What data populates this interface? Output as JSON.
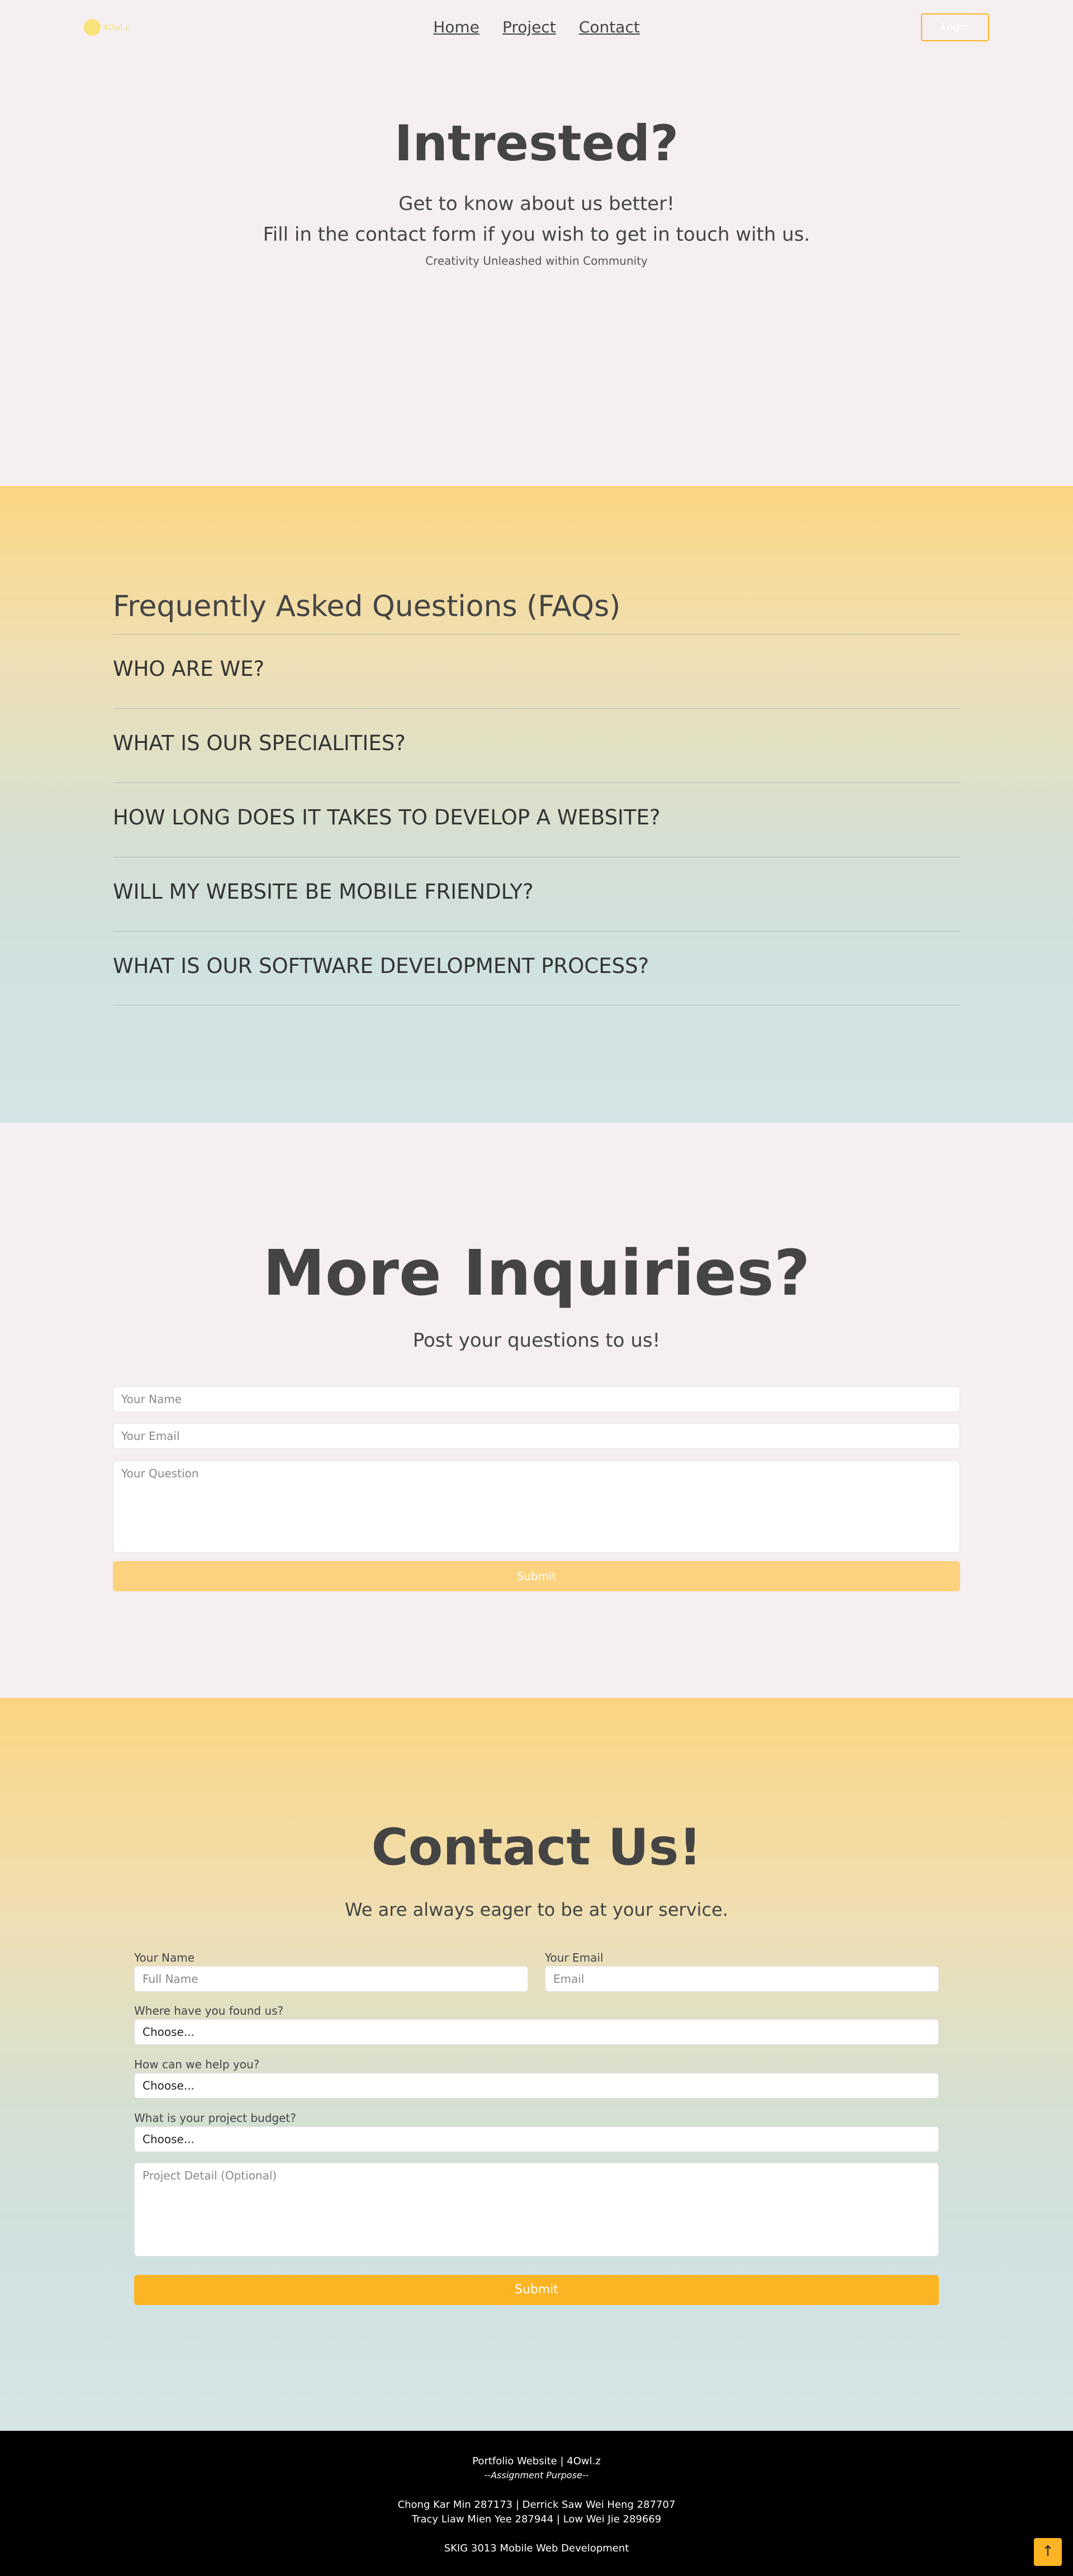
{
  "nav": {
    "logo_text": "4Owl.z",
    "links": [
      "Home",
      "Project",
      "Contact"
    ],
    "login_label": "Login"
  },
  "hero": {
    "title": "Intrested?",
    "line1": "Get to know about us better!",
    "line2": "Fill in the contact form if you wish to get in touch with us.",
    "tagline": "Creativity Unleashed within Community"
  },
  "faq": {
    "title": "Frequently Asked Questions (FAQs)",
    "items": [
      "WHO ARE WE?",
      "WHAT IS OUR SPECIALITIES?",
      "HOW LONG DOES IT TAKES TO DEVELOP A WEBSITE?",
      "WILL MY WEBSITE BE MOBILE FRIENDLY?",
      "WHAT IS OUR SOFTWARE DEVELOPMENT PROCESS?"
    ]
  },
  "inquiries": {
    "title": "More Inquiries?",
    "subtitle": "Post your questions to us!",
    "name_placeholder": "Your Name",
    "email_placeholder": "Your Email",
    "question_placeholder": "Your Question",
    "submit_label": "Submit"
  },
  "contact": {
    "title": "Contact Us!",
    "subtitle": "We are always eager to be at your service.",
    "name_label": "Your Name",
    "name_placeholder": "Full Name",
    "email_label": "Your Email",
    "email_placeholder": "Email",
    "found_label": "Where have you found us?",
    "found_value": "Choose...",
    "help_label": "How can we help you?",
    "help_value": "Choose...",
    "budget_label": "What is your project budget?",
    "budget_value": "Choose...",
    "detail_placeholder": "Project Detail (Optional)",
    "submit_label": "Submit"
  },
  "footer": {
    "line1": "Portfolio Website | 4Owl.z",
    "line2": "--Assignment Purpose--",
    "line3": "Chong Kar Min 287173 | Derrick Saw Wei Heng 287707",
    "line4": "Tracy Liaw Mien Yee 287944 | Low Wei Jie 289669",
    "line5": "SKIG 3013 Mobile Web Development",
    "to_top": "↑"
  }
}
